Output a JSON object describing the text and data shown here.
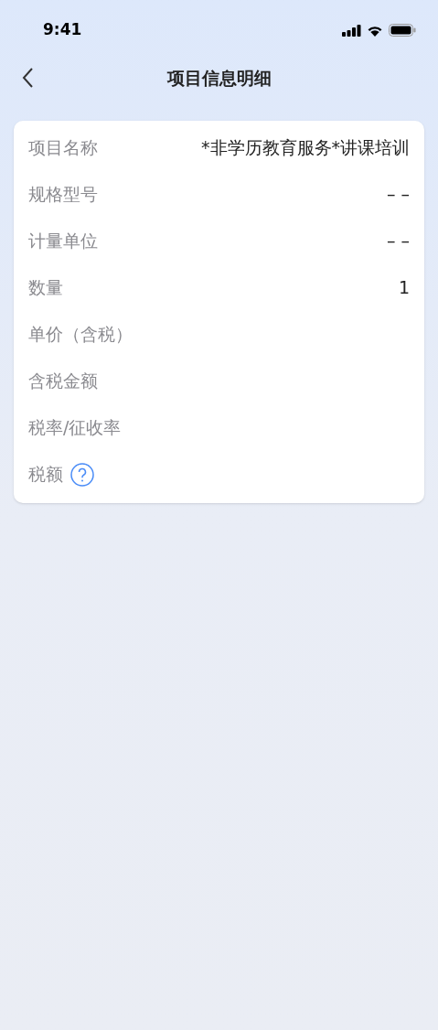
{
  "status_bar": {
    "time": "9:41"
  },
  "nav": {
    "title": "项目信息明细"
  },
  "rows": [
    {
      "label": "项目名称",
      "value": "*非学历教育服务*讲课培训",
      "help": false
    },
    {
      "label": "规格型号",
      "value": "– –",
      "help": false
    },
    {
      "label": "计量单位",
      "value": "– –",
      "help": false
    },
    {
      "label": "数量",
      "value": "1",
      "help": false
    },
    {
      "label": "单价（含税）",
      "help": false
    },
    {
      "label": "含税金额",
      "help": false
    },
    {
      "label": "税率/征收率",
      "help": false
    },
    {
      "label": "税额",
      "help": true
    }
  ]
}
